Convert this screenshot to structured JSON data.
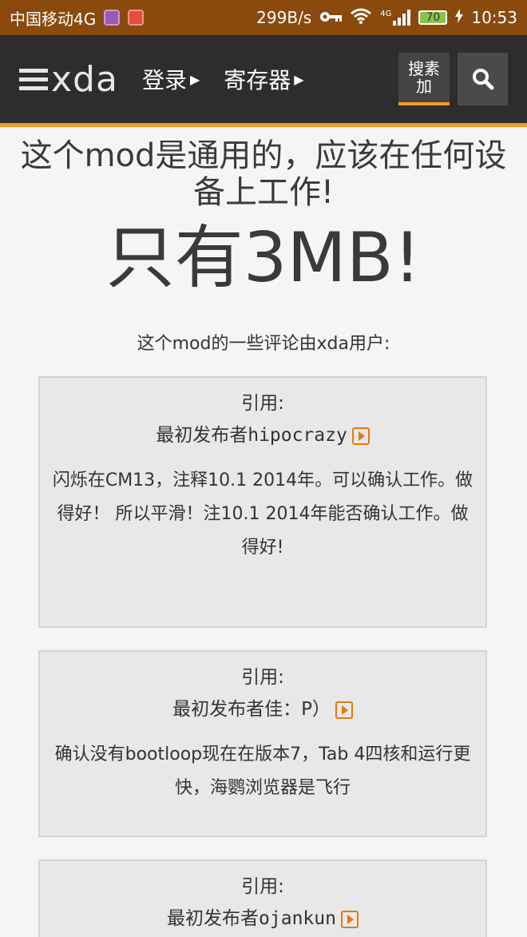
{
  "status_bar": {
    "carrier": "中国移动4G",
    "speed": "299B/s",
    "network_badge": "4G",
    "battery": "70",
    "time": "10:53"
  },
  "header": {
    "logo": "xda",
    "login": "登录",
    "register": "寄存器",
    "search_toggle": "搜素加",
    "icons": [
      "menu-bars-icon",
      "chevron-right-icon",
      "search-icon"
    ]
  },
  "main": {
    "headline": "这个mod是通用的，应该在任何设备上工作!",
    "bigline": "只有3MB!",
    "intro": "这个mod的一些评论由xda用户:"
  },
  "quotes": [
    {
      "label": "引用:",
      "author_prefix": "最初发布者",
      "author": "hipocrazy",
      "body": "闪烁在CM13，注释10.1 2014年。可以确认工作。做得好！ 所以平滑！注10.1 2014年能否确认工作。做得好!"
    },
    {
      "label": "引用:",
      "author_prefix": "最初发布者",
      "author": "佳：P）",
      "body": "确认没有bootloop现在在版本7，Tab 4四核和运行更快，海鹦浏览器是飞行"
    },
    {
      "label": "引用:",
      "author_prefix": "最初发布者",
      "author": "ojankun",
      "body": ""
    }
  ],
  "colors": {
    "status_bar": "#8a4a0e",
    "header": "#2d2d2d",
    "accent": "#f59a23",
    "quote_bg": "#e8e8e8"
  }
}
